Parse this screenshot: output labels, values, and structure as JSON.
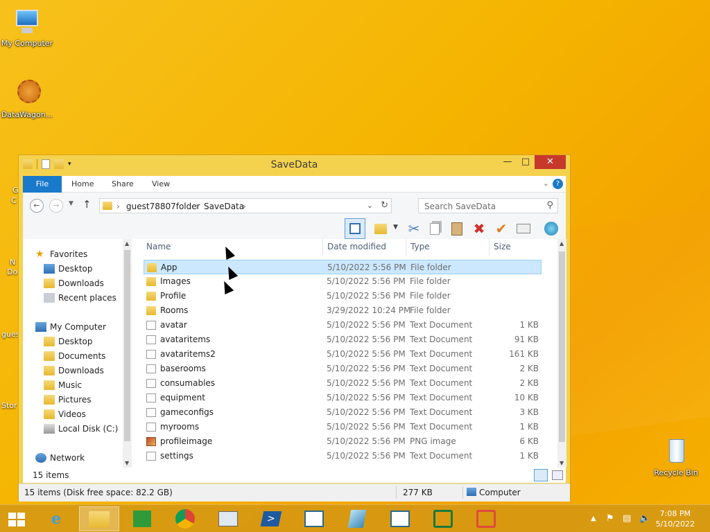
{
  "desktop": {
    "icons": [
      {
        "label": "My Computer"
      },
      {
        "label": "DataWagon..."
      },
      {
        "label": "Recycle Bin"
      }
    ],
    "partial_labels": [
      "G",
      "C",
      "N",
      "Do",
      "gues",
      "Stor"
    ]
  },
  "window": {
    "title": "SaveData",
    "ribbon_tabs": [
      "File",
      "Home",
      "Share",
      "View"
    ],
    "breadcrumb": [
      "guest78807folder",
      "SaveData"
    ],
    "search_placeholder": "Search SaveData",
    "nav": {
      "favorites_label": "Favorites",
      "favorites": [
        "Desktop",
        "Downloads",
        "Recent places"
      ],
      "computer_label": "My Computer",
      "computer": [
        "Desktop",
        "Documents",
        "Downloads",
        "Music",
        "Pictures",
        "Videos",
        "Local Disk (C:)"
      ],
      "network_label": "Network"
    },
    "columns": [
      "Name",
      "Date modified",
      "Type",
      "Size"
    ],
    "files": [
      {
        "name": "App",
        "date": "5/10/2022 5:56 PM",
        "type": "File folder",
        "size": "",
        "kind": "folder",
        "selected": true
      },
      {
        "name": "Images",
        "date": "5/10/2022 5:56 PM",
        "type": "File folder",
        "size": "",
        "kind": "folder"
      },
      {
        "name": "Profile",
        "date": "5/10/2022 5:56 PM",
        "type": "File folder",
        "size": "",
        "kind": "folder"
      },
      {
        "name": "Rooms",
        "date": "3/29/2022 10:24 PM",
        "type": "File folder",
        "size": "",
        "kind": "folder"
      },
      {
        "name": "avatar",
        "date": "5/10/2022 5:56 PM",
        "type": "Text Document",
        "size": "1 KB",
        "kind": "doc"
      },
      {
        "name": "avataritems",
        "date": "5/10/2022 5:56 PM",
        "type": "Text Document",
        "size": "91 KB",
        "kind": "doc"
      },
      {
        "name": "avataritems2",
        "date": "5/10/2022 5:56 PM",
        "type": "Text Document",
        "size": "161 KB",
        "kind": "doc"
      },
      {
        "name": "baserooms",
        "date": "5/10/2022 5:56 PM",
        "type": "Text Document",
        "size": "2 KB",
        "kind": "doc"
      },
      {
        "name": "consumables",
        "date": "5/10/2022 5:56 PM",
        "type": "Text Document",
        "size": "2 KB",
        "kind": "doc"
      },
      {
        "name": "equipment",
        "date": "5/10/2022 5:56 PM",
        "type": "Text Document",
        "size": "10 KB",
        "kind": "doc"
      },
      {
        "name": "gameconfigs",
        "date": "5/10/2022 5:56 PM",
        "type": "Text Document",
        "size": "3 KB",
        "kind": "doc"
      },
      {
        "name": "myrooms",
        "date": "5/10/2022 5:56 PM",
        "type": "Text Document",
        "size": "1 KB",
        "kind": "doc"
      },
      {
        "name": "profileimage",
        "date": "5/10/2022 5:56 PM",
        "type": "PNG image",
        "size": "6 KB",
        "kind": "png"
      },
      {
        "name": "settings",
        "date": "5/10/2022 5:56 PM",
        "type": "Text Document",
        "size": "1 KB",
        "kind": "doc"
      }
    ],
    "item_count": "15 items",
    "status_left": "15 items (Disk free space: 82.2 GB)",
    "status_size": "277 KB",
    "status_location": "Computer"
  },
  "taskbar": {
    "time": "7:08 PM",
    "date": "5/10/2022"
  },
  "colors": {
    "accent": "#1979ca",
    "selection": "#cce8ff",
    "close": "#c7392b"
  }
}
